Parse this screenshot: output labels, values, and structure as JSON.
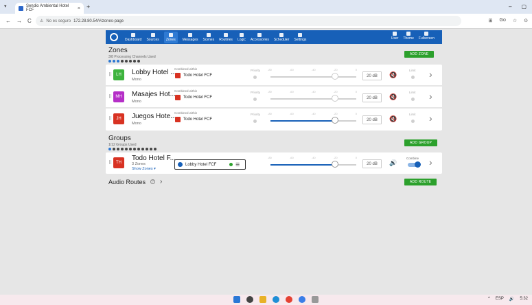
{
  "browser": {
    "tab_title": "Sendio Ambiental Hotel FCF",
    "tab_close": "×",
    "new_tab": "+",
    "dropdown": "▾",
    "url_security": "No es seguro",
    "url": "172.28.80.54/#/zones-page",
    "nav_back": "←",
    "nav_forward": "→",
    "nav_reload": "C",
    "win_min": "–",
    "win_max": "▢",
    "addr_icons": [
      "⊞",
      "Go",
      "☆",
      "⊙"
    ]
  },
  "nav": {
    "items": [
      "Dashboard",
      "Sources",
      "Zones",
      "Messages",
      "Scenes",
      "Routines",
      "Logic",
      "Accessories",
      "Scheduler",
      "Settings"
    ],
    "active": "Zones",
    "right_items": [
      "User",
      "Theme",
      "Fullscreen"
    ]
  },
  "zones_section": {
    "title": "Zones",
    "subtitle": "3/8 Processing Channels Used",
    "add_label": "ADD ZONE",
    "combined_label": "Combined within",
    "priority_label": "Priority",
    "limit_label": "Limit",
    "ticks": [
      "-80",
      "-60",
      "-40",
      "-20",
      "0"
    ],
    "rows": [
      {
        "initials": "LH",
        "name": "Lobby Hotel ...",
        "type": "Mono",
        "group": "Todo Hotel FCF",
        "db": "20 dB",
        "avatar_color": "#3db33d",
        "level_pct": 0.73
      },
      {
        "initials": "MH",
        "name": "Masajes Hot...",
        "type": "Mono",
        "group": "Todo Hotel FCF",
        "db": "20 dB",
        "avatar_color": "#b52fc7",
        "level_pct": 0.73
      },
      {
        "initials": "JH",
        "name": "Juegos Hote...",
        "type": "Mono",
        "group": "Todo Hotel FCF",
        "db": "20 dB",
        "avatar_color": "#d83222",
        "level_pct": 0.73
      }
    ]
  },
  "groups_section": {
    "title": "Groups",
    "subtitle": "1/12 Groups Used",
    "add_label": "ADD GROUP",
    "row": {
      "initials": "TH",
      "name": "Todo Hotel F...",
      "count": "3 Zones",
      "show_zones": "Show Zones ▾",
      "member": "Lobby Hotel FCF",
      "ticks": [
        "-80",
        "-60",
        "-40",
        "-20",
        "0"
      ],
      "db": "20 dB",
      "combine_label": "Combine",
      "avatar_color": "#d83222",
      "level_pct": 0.73
    }
  },
  "audio_routes": {
    "title": "Audio Routes",
    "help": "?",
    "chev": "›",
    "add_label": "ADD ROUTE"
  },
  "taskbar": {
    "right_items": [
      "^",
      "ESP",
      "🔊",
      "5:32"
    ]
  }
}
